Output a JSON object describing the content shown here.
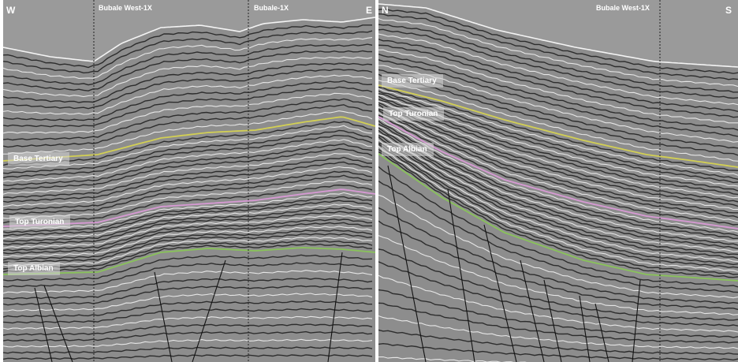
{
  "left_panel": {
    "west_label": "W",
    "east_label": "E",
    "wells": [
      "Bubale West-1X",
      "Bubale-1X"
    ],
    "horizons": [
      "Base Tertiary",
      "Top Turonian",
      "Top Albian"
    ]
  },
  "right_panel": {
    "north_label": "N",
    "south_label": "S",
    "wells": [
      "Bubale West-1X"
    ],
    "horizons": [
      "Base Tertiary",
      "Top Turonian",
      "Top Albian"
    ]
  },
  "colors": {
    "base_tertiary": "#d2cf54",
    "top_turonian": "#d79ad4",
    "top_albian": "#89c25a",
    "faults": "#111111",
    "well_track": "#222222",
    "background": "#9a9a9a"
  }
}
